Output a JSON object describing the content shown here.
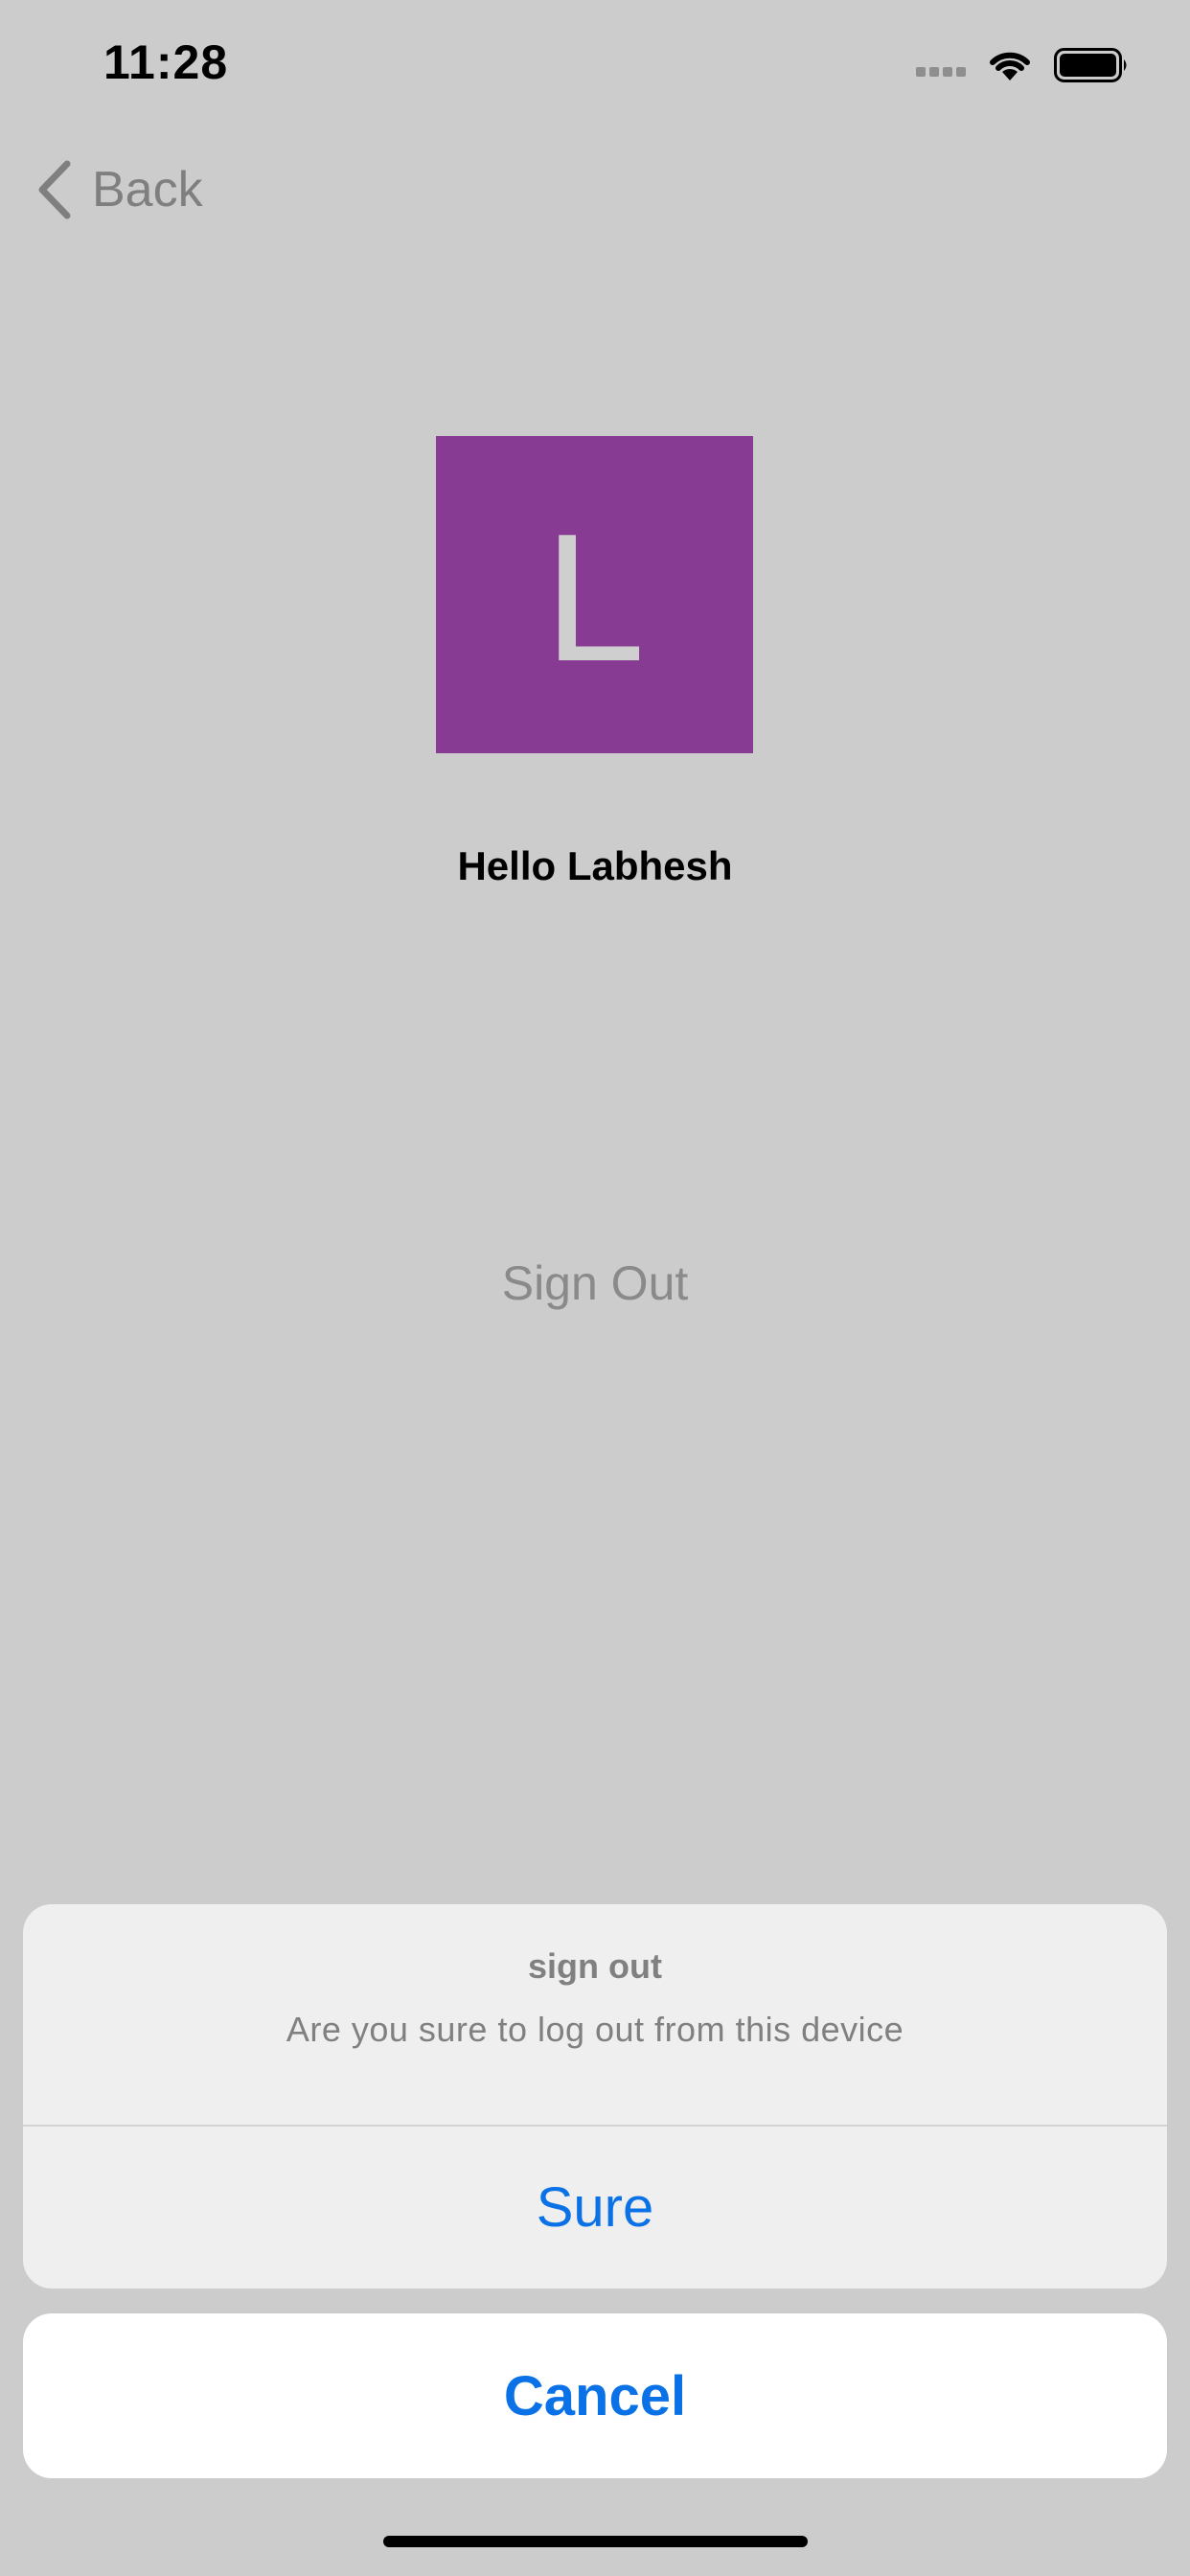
{
  "status_bar": {
    "time": "11:28",
    "signal_icon": "cellular-signal-icon",
    "wifi_icon": "wifi-icon",
    "battery_icon": "battery-icon"
  },
  "nav": {
    "back_icon": "chevron-left-icon",
    "back_label": "Back"
  },
  "profile": {
    "avatar_letter": "L",
    "avatar_color": "#873b92",
    "greeting": "Hello Labhesh"
  },
  "main": {
    "sign_out_label": "Sign Out"
  },
  "action_sheet": {
    "title": "sign out",
    "message": "Are you sure to log out from this device",
    "confirm_label": "Sure",
    "cancel_label": "Cancel",
    "accent_color": "#0a72e6"
  }
}
